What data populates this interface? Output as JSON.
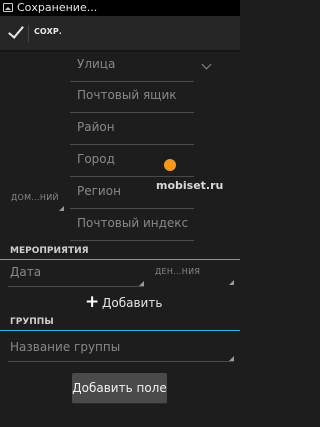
{
  "status_bar": {
    "title": "Сохранение..."
  },
  "action_bar": {
    "save_label": "СОХР."
  },
  "address": {
    "fields": [
      "Улица",
      "Почтовый ящик",
      "Район",
      "Город",
      "Регион",
      "Почтовый индекс"
    ],
    "type_label": "ДОМ...НИЙ"
  },
  "events": {
    "header": "МЕРОПРИЯТИЯ",
    "date_placeholder": "Дата",
    "type_label": "ДЕН...НИЯ",
    "add_label": "Добавить"
  },
  "groups": {
    "header": "ГРУППЫ",
    "placeholder": "Название группы"
  },
  "add_field_label": "Добавить поле",
  "watermark": {
    "text": "mobiset.ru"
  },
  "colors": {
    "accent": "#33b5e5",
    "watermark": "#f39a1d"
  }
}
